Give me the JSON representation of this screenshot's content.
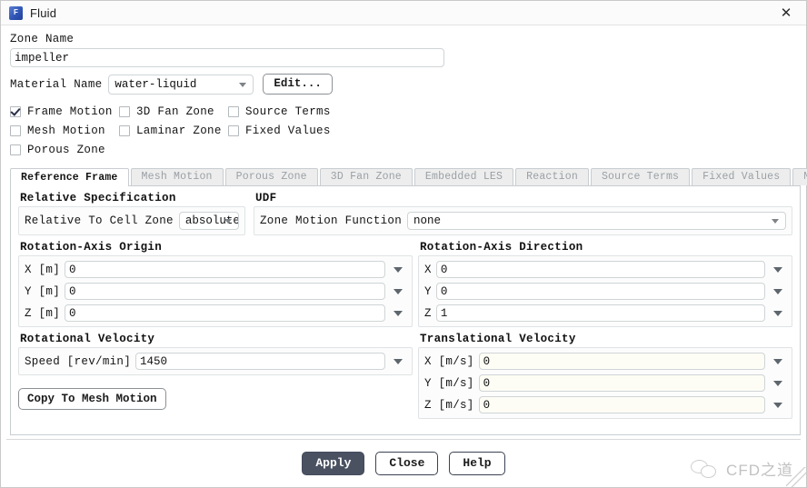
{
  "window": {
    "title": "Fluid",
    "icon": "fluent-app-icon",
    "icon_letter": "F",
    "close_label": "✕"
  },
  "zone": {
    "name_label": "Zone Name",
    "name_value": "impeller",
    "name_placeholder": ""
  },
  "material": {
    "label": "Material Name",
    "value": "water-liquid",
    "edit_label": "Edit..."
  },
  "checkboxes": [
    {
      "label": "Frame Motion",
      "checked": true
    },
    {
      "label": "3D Fan Zone",
      "checked": false
    },
    {
      "label": "Source Terms",
      "checked": false
    },
    {
      "label": "Mesh Motion",
      "checked": false
    },
    {
      "label": "Laminar Zone",
      "checked": false
    },
    {
      "label": "Fixed Values",
      "checked": false
    },
    {
      "label": "Porous Zone",
      "checked": false
    }
  ],
  "tabs": [
    {
      "label": "Reference Frame",
      "active": true
    },
    {
      "label": "Mesh Motion",
      "active": false
    },
    {
      "label": "Porous Zone",
      "active": false
    },
    {
      "label": "3D Fan Zone",
      "active": false
    },
    {
      "label": "Embedded LES",
      "active": false
    },
    {
      "label": "Reaction",
      "active": false
    },
    {
      "label": "Source Terms",
      "active": false
    },
    {
      "label": "Fixed Values",
      "active": false
    },
    {
      "label": "Multiphase",
      "active": false
    }
  ],
  "reference_frame": {
    "relative_specification": {
      "heading": "Relative Specification",
      "field_label": "Relative To Cell Zone",
      "value": "absolute"
    },
    "udf": {
      "heading": "UDF",
      "field_label": "Zone Motion Function",
      "value": "none"
    },
    "rotation_axis_origin": {
      "heading": "Rotation-Axis Origin",
      "rows": [
        {
          "label": "X [m]",
          "value": "0"
        },
        {
          "label": "Y [m]",
          "value": "0"
        },
        {
          "label": "Z [m]",
          "value": "0"
        }
      ]
    },
    "rotation_axis_direction": {
      "heading": "Rotation-Axis Direction",
      "rows": [
        {
          "label": "X",
          "value": "0"
        },
        {
          "label": "Y",
          "value": "0"
        },
        {
          "label": "Z",
          "value": "1"
        }
      ]
    },
    "rotational_velocity": {
      "heading": "Rotational Velocity",
      "speed_label": "Speed [rev/min]",
      "speed_value": "1450",
      "copy_button": "Copy To Mesh Motion"
    },
    "translational_velocity": {
      "heading": "Translational Velocity",
      "rows": [
        {
          "label": "X [m/s]",
          "value": "0"
        },
        {
          "label": "Y [m/s]",
          "value": "0"
        },
        {
          "label": "Z [m/s]",
          "value": "0"
        }
      ]
    }
  },
  "footer": {
    "apply_label": "Apply",
    "close_label": "Close",
    "help_label": "Help",
    "watermark_text": "CFD之道",
    "watermark_icon": "wechat-icon"
  },
  "colors": {
    "accent": "#4a5262",
    "field_border": "#cfd4d6",
    "group_border": "#dfe3e5",
    "tab_inactive_text": "#9aa0a5"
  }
}
